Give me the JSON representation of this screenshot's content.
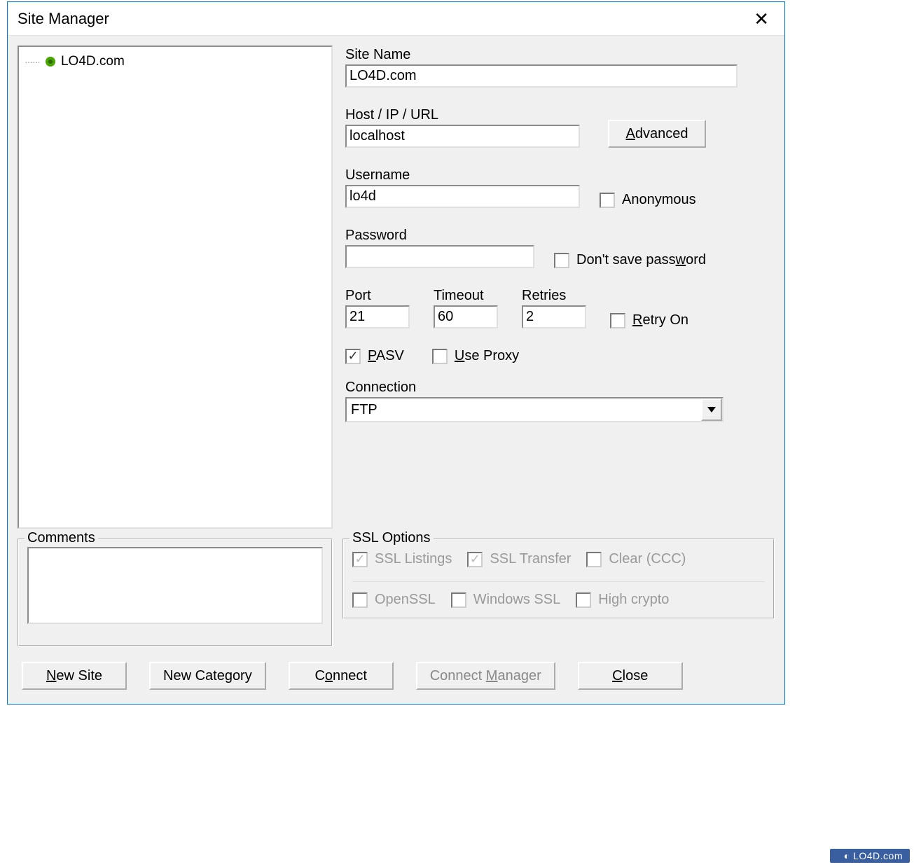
{
  "window": {
    "title": "Site Manager"
  },
  "tree": {
    "items": [
      "LO4D.com"
    ]
  },
  "form": {
    "site_name_label": "Site Name",
    "site_name_value": "LO4D.com",
    "host_label": "Host / IP / URL",
    "host_value": "localhost",
    "advanced_btn": "Advanced",
    "username_label": "Username",
    "username_value": "lo4d",
    "anonymous_label": "Anonymous",
    "password_label": "Password",
    "password_value": "",
    "dont_save_pw_label": "Don't save password",
    "port_label": "Port",
    "port_value": "21",
    "timeout_label": "Timeout",
    "timeout_value": "60",
    "retries_label": "Retries",
    "retries_value": "2",
    "retry_on_label": "Retry On",
    "pasv_label": "PASV",
    "use_proxy_label": "Use Proxy",
    "connection_label": "Connection",
    "connection_value": "FTP"
  },
  "comments": {
    "legend": "Comments",
    "value": ""
  },
  "ssl": {
    "legend": "SSL Options",
    "ssl_listings": "SSL Listings",
    "ssl_transfer": "SSL Transfer",
    "clear_ccc": "Clear (CCC)",
    "openssl": "OpenSSL",
    "windows_ssl": "Windows SSL",
    "high_crypto": "High crypto"
  },
  "buttons": {
    "new_site": "New Site",
    "new_category": "New Category",
    "connect": "Connect",
    "connect_manager": "Connect Manager",
    "close": "Close"
  },
  "watermark": "LO4D.com"
}
